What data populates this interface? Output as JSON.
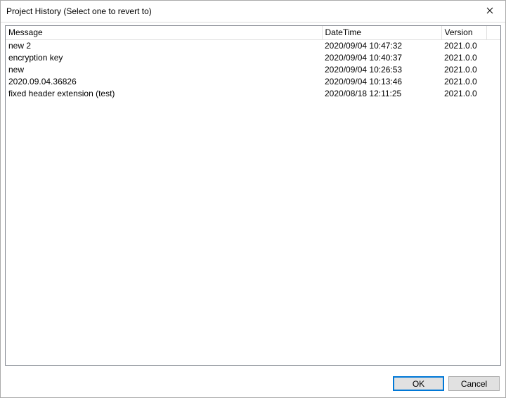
{
  "window": {
    "title": "Project History (Select one to revert to)"
  },
  "columns": {
    "message": "Message",
    "datetime": "DateTime",
    "version": "Version"
  },
  "rows": [
    {
      "message": "new 2",
      "datetime": "2020/09/04 10:47:32",
      "version": "2021.0.0"
    },
    {
      "message": "encryption key",
      "datetime": "2020/09/04 10:40:37",
      "version": "2021.0.0"
    },
    {
      "message": "new",
      "datetime": "2020/09/04 10:26:53",
      "version": "2021.0.0"
    },
    {
      "message": "2020.09.04.36826",
      "datetime": "2020/09/04 10:13:46",
      "version": "2021.0.0"
    },
    {
      "message": "fixed header extension (test)",
      "datetime": "2020/08/18 12:11:25",
      "version": "2021.0.0"
    }
  ],
  "buttons": {
    "ok": "OK",
    "cancel": "Cancel"
  }
}
